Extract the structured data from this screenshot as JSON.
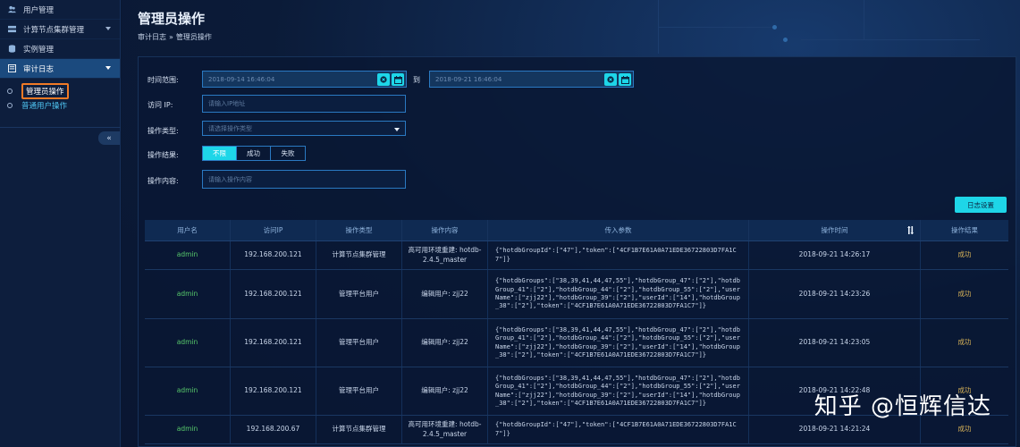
{
  "sidebar": {
    "items": [
      {
        "label": "用户管理",
        "icon": "users-icon"
      },
      {
        "label": "计算节点集群管理",
        "icon": "cluster-icon",
        "has_caret": true
      },
      {
        "label": "实例管理",
        "icon": "database-icon"
      },
      {
        "label": "审计日志",
        "icon": "log-icon",
        "has_caret": true,
        "active": true
      }
    ],
    "sub_items": [
      {
        "label": "管理员操作",
        "current": true
      },
      {
        "label": "普通用户操作"
      }
    ],
    "collapse_label": "«"
  },
  "header": {
    "title": "管理员操作",
    "breadcrumb": [
      "审计日志",
      "管理员操作"
    ],
    "breadcrumb_sep": "»"
  },
  "filters": {
    "time_label": "时间范围:",
    "start_time": "2018-09-14 16:46:04",
    "to_label": "到",
    "end_time": "2018-09-21 16:46:04",
    "ip_label": "访问 IP:",
    "ip_placeholder": "请输入IP地址",
    "type_label": "操作类型:",
    "type_placeholder": "请选择操作类型",
    "result_label": "操作结果:",
    "result_options": [
      "不限",
      "成功",
      "失败"
    ],
    "result_selected": 0,
    "content_label": "操作内容:",
    "content_placeholder": "请输入操作内容",
    "settings_label": "日志设置"
  },
  "table": {
    "columns": [
      "用户名",
      "访问IP",
      "操作类型",
      "操作内容",
      "传入参数",
      "操作时间",
      "操作结果"
    ],
    "rows": [
      {
        "user": "admin",
        "ip": "192.168.200.121",
        "type": "计算节点集群管理",
        "content": "高可用环境重建: hotdb-2.4.5_master",
        "params": "{\"hotdbGroupId\":[\"47\"],\"token\":[\"4CF1B7E61A0A71EDE36722803D7FA1C7\"]}",
        "time": "2018-09-21 14:26:17",
        "result": "成功"
      },
      {
        "user": "admin",
        "ip": "192.168.200.121",
        "type": "管理平台用户",
        "content": "编辑用户: zjj22",
        "params": "{\"hotdbGroups\":[\"38,39,41,44,47,55\"],\"hotdbGroup_47\":[\"2\"],\"hotdbGroup_41\":[\"2\"],\"hotdbGroup_44\":[\"2\"],\"hotdbGroup_55\":[\"2\"],\"userName\":[\"zjj22\"],\"hotdbGroup_39\":[\"2\"],\"userId\":[\"14\"],\"hotdbGroup_38\":[\"2\"],\"token\":[\"4CF1B7E61A0A71EDE36722803D7FA1C7\"]}",
        "time": "2018-09-21 14:23:26",
        "result": "成功"
      },
      {
        "user": "admin",
        "ip": "192.168.200.121",
        "type": "管理平台用户",
        "content": "编辑用户: zjj22",
        "params": "{\"hotdbGroups\":[\"38,39,41,44,47,55\"],\"hotdbGroup_47\":[\"2\"],\"hotdbGroup_41\":[\"2\"],\"hotdbGroup_44\":[\"2\"],\"hotdbGroup_55\":[\"2\"],\"userName\":[\"zjj22\"],\"hotdbGroup_39\":[\"2\"],\"userId\":[\"14\"],\"hotdbGroup_38\":[\"2\"],\"token\":[\"4CF1B7E61A0A71EDE36722803D7FA1C7\"]}",
        "time": "2018-09-21 14:23:05",
        "result": "成功"
      },
      {
        "user": "admin",
        "ip": "192.168.200.121",
        "type": "管理平台用户",
        "content": "编辑用户: zjj22",
        "params": "{\"hotdbGroups\":[\"38,39,41,44,47,55\"],\"hotdbGroup_47\":[\"2\"],\"hotdbGroup_41\":[\"2\"],\"hotdbGroup_44\":[\"2\"],\"hotdbGroup_55\":[\"2\"],\"userName\":[\"zjj22\"],\"hotdbGroup_39\":[\"2\"],\"userId\":[\"14\"],\"hotdbGroup_38\":[\"2\"],\"token\":[\"4CF1B7E61A0A71EDE36722803D7FA1C7\"]}",
        "time": "2018-09-21 14:22:48",
        "result": "成功"
      },
      {
        "user": "admin",
        "ip": "192.168.200.67",
        "type": "计算节点集群管理",
        "content": "高可用环境重建: hotdb-2.4.5_master",
        "params": "{\"hotdbGroupId\":[\"47\"],\"token\":[\"4CF1B7E61A0A71EDE36722803D7FA1C7\"]}",
        "time": "2018-09-21 14:21:24",
        "result": "成功"
      }
    ]
  },
  "watermark": "知乎 @恒辉信达",
  "colors": {
    "accent": "#1ed6e8",
    "sidebar_active": "#1b4a7e",
    "highlight_border": "#f07a26",
    "user_green": "#57c96b",
    "result_gold": "#d9b357"
  }
}
